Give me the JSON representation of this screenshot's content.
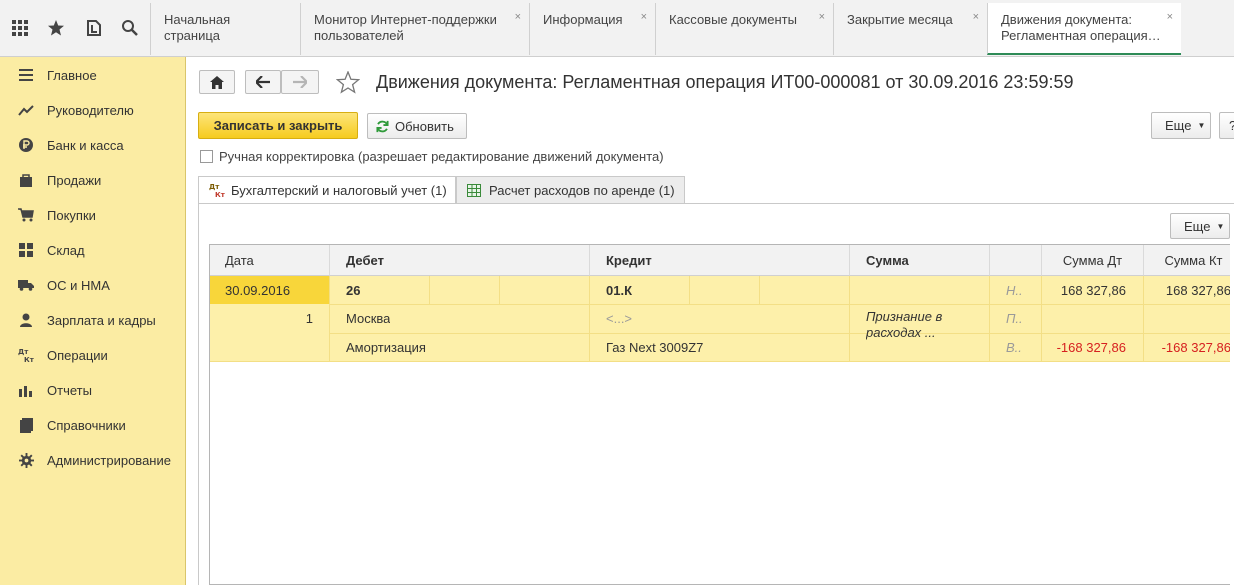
{
  "top_tabs": [
    {
      "label": "Начальная страница",
      "closable": false
    },
    {
      "label": "Монитор Интернет-поддержки пользователей",
      "closable": true
    },
    {
      "label": "Информация",
      "closable": true
    },
    {
      "label": "Кассовые документы",
      "closable": true
    },
    {
      "label": "Закрытие месяца",
      "closable": true
    },
    {
      "label": "Движения документа: Регламентная операция…",
      "closable": true,
      "active": true
    }
  ],
  "tab_close_glyph": "×",
  "sidebar": {
    "items": [
      {
        "label": "Главное",
        "icon": "menu-lines-icon"
      },
      {
        "label": "Руководителю",
        "icon": "trend-icon"
      },
      {
        "label": "Банк и касса",
        "icon": "ruble-coin-icon"
      },
      {
        "label": "Продажи",
        "icon": "bag-icon"
      },
      {
        "label": "Покупки",
        "icon": "cart-icon"
      },
      {
        "label": "Склад",
        "icon": "grid-icon"
      },
      {
        "label": "ОС и НМА",
        "icon": "truck-icon"
      },
      {
        "label": "Зарплата и кадры",
        "icon": "person-icon"
      },
      {
        "label": "Операции",
        "icon": "dt-kt-icon"
      },
      {
        "label": "Отчеты",
        "icon": "bar-chart-icon"
      },
      {
        "label": "Справочники",
        "icon": "book-icon"
      },
      {
        "label": "Администрирование",
        "icon": "gear-icon"
      }
    ]
  },
  "page": {
    "title": "Движения документа: Регламентная операция ИТ00-000081 от 30.09.2016 23:59:59"
  },
  "toolbar": {
    "save_close_label": "Записать и закрыть",
    "refresh_label": "Обновить",
    "more_label": "Еще",
    "help_label": "?"
  },
  "manual_correction": {
    "label": "Ручная корректировка (разрешает редактирование движений документа)",
    "checked": false
  },
  "doc_tabs": [
    {
      "label": "Бухгалтерский и налоговый учет (1)",
      "active": true
    },
    {
      "label": "Расчет расходов по аренде (1)",
      "active": false
    }
  ],
  "grid_more_label": "Еще",
  "table": {
    "headers": {
      "date": "Дата",
      "debit": "Дебет",
      "credit": "Кредит",
      "sum": "Сумма",
      "sum_dt": "Сумма Дт",
      "sum_kt": "Сумма Кт"
    },
    "row": {
      "date": "30.09.2016",
      "number": "1",
      "debit_account": "26",
      "debit_sub1": "Москва",
      "debit_sub2": "Амортизация",
      "credit_account": "01.К",
      "credit_sub1": "<...>",
      "credit_sub2": "Газ Next 3009Z7",
      "content": "Признание в расходах ...",
      "flag_n": "Н..",
      "flag_p": "П..",
      "flag_v": "В..",
      "sum_dt": "168 327,86",
      "sum_kt": "168 327,86",
      "diff_dt": "-168 327,86",
      "diff_kt": "-168 327,86"
    }
  },
  "colors": {
    "sidebar_bg": "#fbeca3",
    "primary_button": "#f6cc1f",
    "row_highlight": "#fdf0aa",
    "active_cell": "#f8d63a",
    "negative": "#d62020",
    "active_tab_accent": "#2e8b57"
  }
}
